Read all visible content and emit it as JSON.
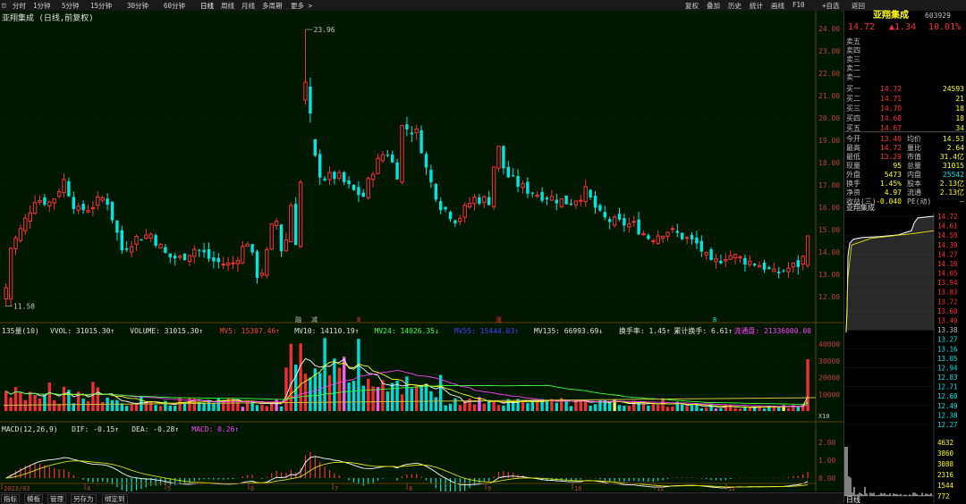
{
  "topbar": {
    "left_items": [
      "分时",
      "1分钟",
      "5分钟",
      "15分钟",
      "30分钟",
      "60分钟",
      "日线",
      "周线",
      "月线",
      "多周期",
      "更多 >"
    ],
    "right_items": [
      "复权",
      "叠加",
      "历史",
      "统计",
      "画线",
      "F10",
      "+自选",
      "返回"
    ]
  },
  "chart_title": "亚翔集成 (日线,前复权)",
  "price_axis": [
    "24.00",
    "23.00",
    "22.00",
    "21.00",
    "20.00",
    "19.00",
    "18.00",
    "17.00",
    "16.00",
    "15.00",
    "14.00",
    "13.00",
    "12.00"
  ],
  "max_label": "23.96",
  "min_label": "11.58",
  "markers": [
    "融",
    "减",
    "B",
    "涨",
    "B"
  ],
  "volume_header": {
    "label": "135量(10)",
    "items": [
      "VVOL: 31015.30↑",
      "VOLUME: 31015.30↑",
      "MV5: 15307.46↑",
      "MV10: 14110.19↑",
      "MV24: 14026.35↓",
      "MV55: 15444.03↑",
      "MV135: 66993.69↓",
      "换手率: 1.45↑",
      "累计换手: 6.61↑",
      "流通盘: 21336000.00"
    ]
  },
  "volume_axis": [
    "40000",
    "30000",
    "20000",
    "10000"
  ],
  "volume_unit": "X10",
  "macd_header": [
    "MACD(12,26,9)",
    "DIF: -0.15↑",
    "DEA: -0.28↑",
    "MACD: 0.26↑"
  ],
  "macd_axis": [
    "2.00",
    "1.00",
    "0.00"
  ],
  "month_labels": [
    "2023/03",
    "4",
    "5",
    "6",
    "7",
    "8",
    "9",
    "10",
    "11",
    "12"
  ],
  "quote": {
    "name": "亚翔集成",
    "code": "603929",
    "price": "14.72",
    "change": "▲1.34",
    "pct": "10.01%",
    "sells": [
      [
        "卖五",
        "",
        ""
      ],
      [
        "卖四",
        "",
        ""
      ],
      [
        "卖三",
        "",
        ""
      ],
      [
        "卖二",
        "",
        ""
      ],
      [
        "卖一",
        "",
        ""
      ]
    ],
    "buys": [
      [
        "买一",
        "14.72",
        "24593"
      ],
      [
        "买二",
        "14.71",
        "21"
      ],
      [
        "买三",
        "14.70",
        "18"
      ],
      [
        "买四",
        "14.68",
        "18"
      ],
      [
        "买五",
        "14.67",
        "34"
      ]
    ],
    "stats": [
      [
        "今开",
        "13.40",
        "均价",
        "14.53"
      ],
      [
        "最高",
        "14.72",
        "量比",
        "2.64"
      ],
      [
        "最低",
        "13.29",
        "市值",
        "31.4亿"
      ],
      [
        "现量",
        "95",
        "总量",
        "31015"
      ],
      [
        "外盘",
        "5473",
        "内盘",
        "25542"
      ],
      [
        "换手",
        "1.45%",
        "股本",
        "2.13亿"
      ],
      [
        "净资",
        "4.97",
        "流通",
        "2.13亿"
      ],
      [
        "收益(三)",
        "-0.040",
        "PE(动)",
        "—"
      ]
    ],
    "mini_title": "亚翔集成",
    "mini_axis": [
      "14.72",
      "14.61",
      "14.50",
      "14.39",
      "14.27",
      "14.16",
      "14.05",
      "13.94",
      "13.83",
      "13.72",
      "13.60",
      "13.49",
      "13.38",
      "13.27",
      "13.16",
      "13.05",
      "12.94",
      "12.83",
      "12.71",
      "12.60",
      "12.49",
      "12.38",
      "12.27"
    ],
    "mini_vol_axis": [
      "4632",
      "3860",
      "3088",
      "2316",
      "1544",
      "772"
    ],
    "mini_tab": "日线"
  },
  "bottombar": [
    "指标",
    "模板",
    "管理",
    "另存为",
    "绑定到"
  ],
  "colors": {
    "up": "#ff3030",
    "down": "#00e5e5",
    "bg": "#001800",
    "yellow": "#ffff00"
  }
}
